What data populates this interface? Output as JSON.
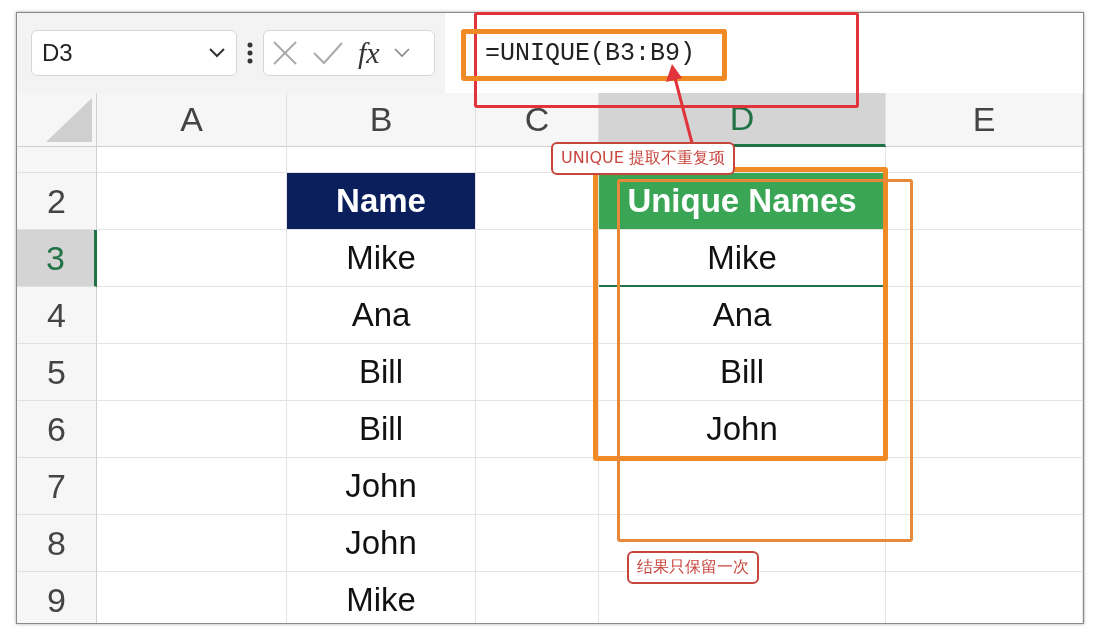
{
  "formula_bar": {
    "name_box": "D3",
    "fx": "fx",
    "formula": "=UNIQUE(B3:B9)"
  },
  "columns": [
    {
      "label": "A",
      "selected": false
    },
    {
      "label": "B",
      "selected": false
    },
    {
      "label": "C",
      "selected": false
    },
    {
      "label": "D",
      "selected": true
    },
    {
      "label": "E",
      "selected": false
    }
  ],
  "rows": [
    {
      "number": "2",
      "selected": false,
      "cells": {
        "column_b": {
          "text": "Name",
          "kind": "heading",
          "color": "#0b1f5c"
        },
        "column_d": {
          "text": "Unique Names",
          "kind": "heading",
          "color": "#3aa655"
        }
      }
    },
    {
      "number": "3",
      "selected": true,
      "cells": {
        "column_b": {
          "text": "Mike",
          "kind": "plain"
        },
        "column_d": {
          "text": "Mike",
          "kind": "plain",
          "selected": true
        }
      }
    },
    {
      "number": "4",
      "selected": false,
      "cells": {
        "column_b": {
          "text": "Ana",
          "kind": "plain"
        },
        "column_d": {
          "text": "Ana",
          "kind": "plain"
        }
      }
    },
    {
      "number": "5",
      "selected": false,
      "cells": {
        "column_b": {
          "text": "Bill",
          "kind": "plain"
        },
        "column_d": {
          "text": "Bill",
          "kind": "plain"
        }
      }
    },
    {
      "number": "6",
      "selected": false,
      "cells": {
        "column_b": {
          "text": "Bill",
          "kind": "plain"
        },
        "column_d": {
          "text": "John",
          "kind": "plain"
        }
      }
    },
    {
      "number": "7",
      "selected": false,
      "cells": {
        "column_b": {
          "text": "John",
          "kind": "plain"
        }
      }
    },
    {
      "number": "8",
      "selected": false,
      "cells": {
        "column_b": {
          "text": "John",
          "kind": "plain"
        }
      }
    },
    {
      "number": "9",
      "selected": false,
      "cells": {
        "column_b": {
          "text": "Mike",
          "kind": "plain"
        }
      }
    }
  ],
  "annotations": [
    {
      "kind": "callout",
      "text": "UNIQUE 提取不重复项"
    },
    {
      "kind": "callout",
      "text": "结果只保留一次"
    }
  ]
}
